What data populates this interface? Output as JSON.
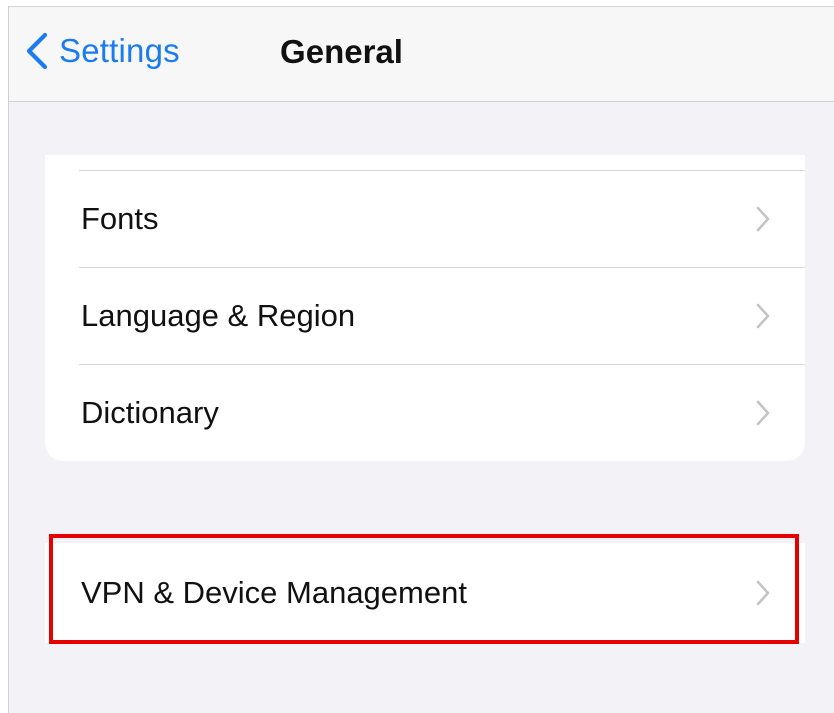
{
  "nav": {
    "back_label": "Settings",
    "title": "General",
    "accent_color": "#1a7cf0"
  },
  "rows": [
    {
      "label": "Fonts",
      "icon": "chevron-right-icon"
    },
    {
      "label": "Language & Region",
      "icon": "chevron-right-icon"
    },
    {
      "label": "Dictionary",
      "icon": "chevron-right-icon"
    }
  ],
  "vpn_row": {
    "label": "VPN & Device Management",
    "icon": "chevron-right-icon",
    "highlight_color": "#e60000"
  }
}
